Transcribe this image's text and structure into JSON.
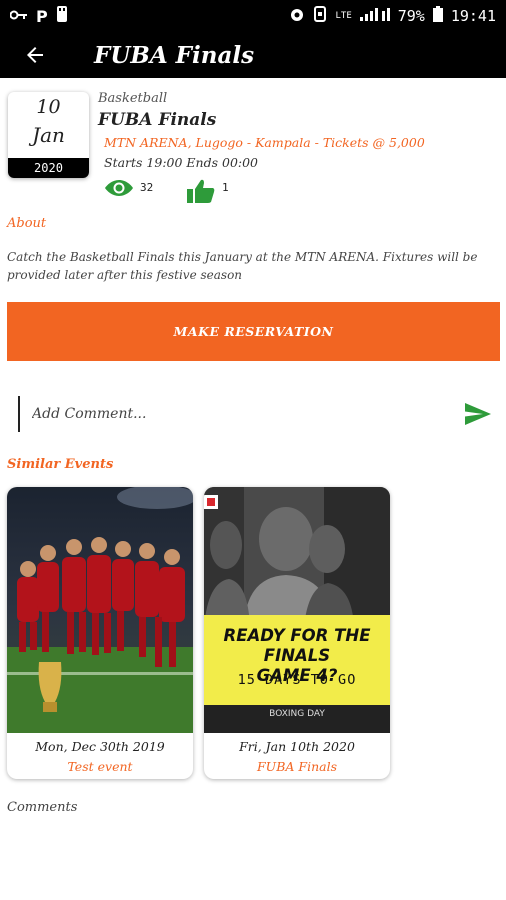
{
  "status_bar": {
    "battery_percent": "79%",
    "time": "19:41",
    "network": "LTE"
  },
  "app_bar": {
    "title": "FUBA Finals"
  },
  "event": {
    "day": "10",
    "month": "Jan",
    "year": "2020",
    "category": "Basketball",
    "title": "FUBA Finals",
    "venue_line": "MTN ARENA, Lugogo - Kampala - Tickets @ 5,000",
    "time_line": "Starts 19:00 Ends 00:00",
    "views": "32",
    "likes": "1"
  },
  "about": {
    "label": "About",
    "text": "Catch the Basketball Finals this January at the MTN ARENA. Fixtures will be provided later after this festive season"
  },
  "reservation": {
    "button_label": "MAKE RESERVATION"
  },
  "comment": {
    "placeholder": "Add Comment..."
  },
  "similar": {
    "label": "Similar Events",
    "events": [
      {
        "date": "Mon, Dec 30th 2019",
        "name": "Test event"
      },
      {
        "date": "Fri, Jan 10th 2020",
        "name": "FUBA Finals"
      }
    ],
    "promo": {
      "headline_1": "READY FOR THE FINALS",
      "headline_2": "GAME 4?",
      "sub": "15 DAYS TO GO",
      "footer": "BOXING DAY"
    }
  },
  "comments": {
    "label": "Comments"
  },
  "colors": {
    "accent": "#f26522",
    "icon_green": "#2e9b3a",
    "promo_yellow": "#f2ec4a"
  }
}
